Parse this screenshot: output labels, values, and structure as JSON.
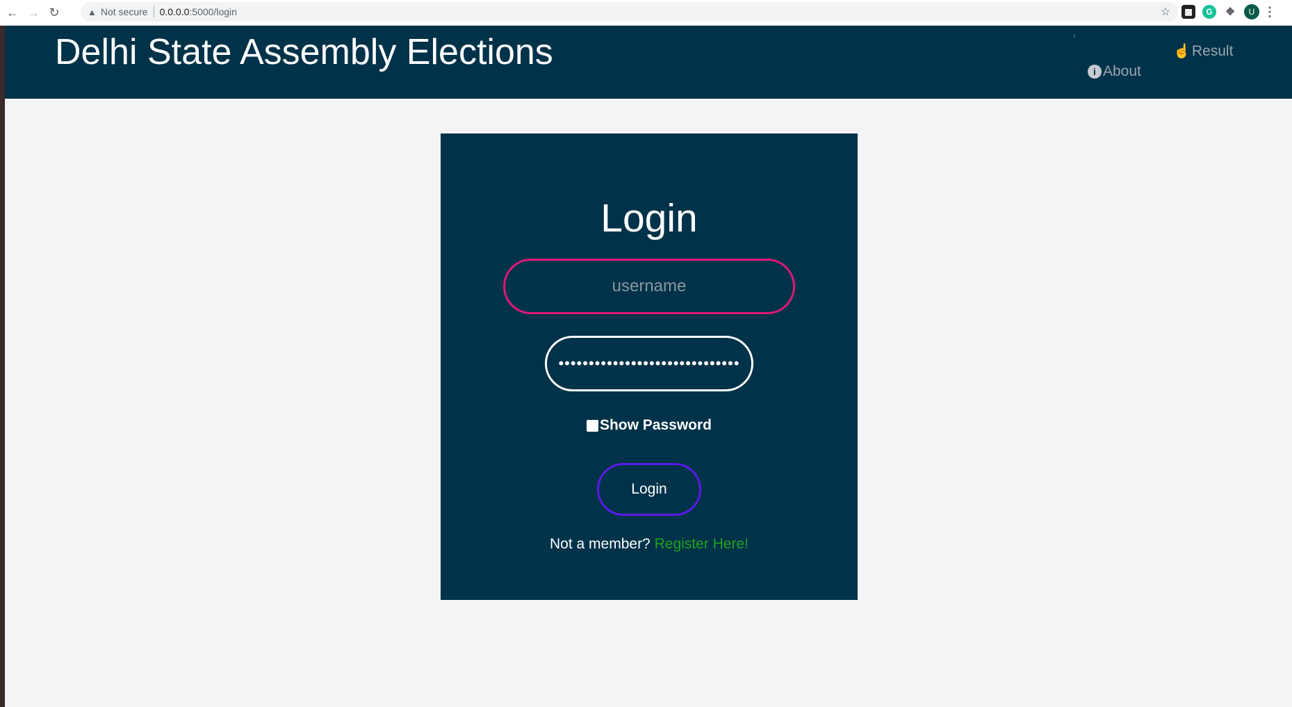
{
  "browser": {
    "security_label": "Not secure",
    "url_host": "0.0.0.0",
    "url_path": ":5000/login",
    "avatar_letter": "U"
  },
  "header": {
    "title": "Delhi State Assembly Elections",
    "nav": {
      "result_label": "Result",
      "about_label": "About"
    }
  },
  "login_form": {
    "title": "Login",
    "username_placeholder": "username",
    "password_value": "••••••••••••••••••••••••••••••",
    "show_password_label": "Show Password",
    "submit_label": "Login",
    "member_prompt": "Not a member?",
    "register_link": "Register Here!"
  },
  "colors": {
    "header_bg": "#003249",
    "card_bg": "#003249",
    "username_border": "#e0187a",
    "button_border": "#5b1ae8",
    "link_green": "#1fa11f"
  }
}
